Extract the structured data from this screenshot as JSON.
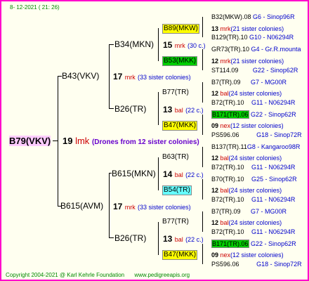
{
  "header": {
    "date": "8- 12-2021 ( 21: 26)"
  },
  "footer": {
    "copyright": "Copyright 2004-2021 @ Karl Kehrle Foundation",
    "site": "www.pedigreeapis.org"
  },
  "colors": {
    "border": "#ff00cc",
    "yellow": "#ffff00",
    "green": "#00cc00",
    "cyan": "#66ffff",
    "root_bg": "#ffccff"
  },
  "root": {
    "label": "B79(VKV)",
    "count": "19",
    "unit": "lmk",
    "note": "(Drones from 12 sister colonies)"
  },
  "gen1": [
    {
      "label": "B43(VKV)",
      "count": "17",
      "unit": "mrk",
      "note": "(33 sister colonies)"
    },
    {
      "label": "B615(AVM)",
      "count": "17",
      "unit": "mrk",
      "note": "(33 sister colonies)"
    }
  ],
  "gen2": [
    {
      "label": "B34(MKN)",
      "count": "15",
      "unit": "mrk",
      "note": "(30 c.)"
    },
    {
      "label": "B26(TR)",
      "count": "13",
      "unit": "bal",
      "note": "(22 c.)"
    },
    {
      "label": "B615(MKN)",
      "count": "14",
      "unit": "bal",
      "note": "(22 c.)"
    },
    {
      "label": "B26(TR)",
      "count": "13",
      "unit": "bal",
      "note": "(22 c.)"
    }
  ],
  "gen3": [
    {
      "label": "B89(MKW)",
      "count": "13",
      "unit": "mrk",
      "note": "(21 sister colonies)"
    },
    {
      "label": "B53(MKK)",
      "count": "12",
      "unit": "mrk",
      "note": "(21 sister colonies)"
    },
    {
      "label": "B77(TR)",
      "count": "12",
      "unit": "bal",
      "note": "(24 sister colonies)"
    },
    {
      "label": "B47(MKK)",
      "count": "09",
      "unit": "nex",
      "note": "(12 sister colonies)"
    },
    {
      "label": "B63(TR)",
      "count": "12",
      "unit": "bal",
      "note": "(24 sister colonies)"
    },
    {
      "label": "B54(TR)",
      "count": "12",
      "unit": "bal",
      "note": "(24 sister colonies)"
    },
    {
      "label": "B77(TR)",
      "count": "12",
      "unit": "bal",
      "note": "(24 sister colonies)"
    },
    {
      "label": "B47(MKK)",
      "count": "09",
      "unit": "nex",
      "note": "(12 sister colonies)"
    }
  ],
  "gen4": [
    {
      "label": "B32(MKW).08",
      "code": "G6 - Sinop96R"
    },
    {
      "label": "B129(TR).10",
      "code": "G10 - N06294R"
    },
    {
      "label": "GR73(TR).10",
      "code": "G4 - Gr.R.mounta"
    },
    {
      "label": "ST114.09",
      "code": "G22 - Sinop62R"
    },
    {
      "label": "B7(TR).09",
      "code": "G7 - MG00R"
    },
    {
      "label": "B72(TR).10",
      "code": "G11 - N06294R"
    },
    {
      "label": "B171(TR).06",
      "code": "G22 - Sinop62R"
    },
    {
      "label": "PS596.06",
      "code": "G18 - Sinop72R"
    },
    {
      "label": "B137(TR).11",
      "code": "G8 - Kangaroo98R"
    },
    {
      "label": "B72(TR).10",
      "code": "G11 - N06294R"
    },
    {
      "label": "B70(TR).10",
      "code": "G25 - Sinop62R"
    },
    {
      "label": "B72(TR).10",
      "code": "G11 - N06294R"
    },
    {
      "label": "B7(TR).09",
      "code": "G7 - MG00R"
    },
    {
      "label": "B72(TR).10",
      "code": "G11 - N06294R"
    },
    {
      "label": "B171(TR).06",
      "code": "G22 - Sinop62R"
    },
    {
      "label": "PS596.06",
      "code": "G18 - Sinop72R"
    }
  ]
}
